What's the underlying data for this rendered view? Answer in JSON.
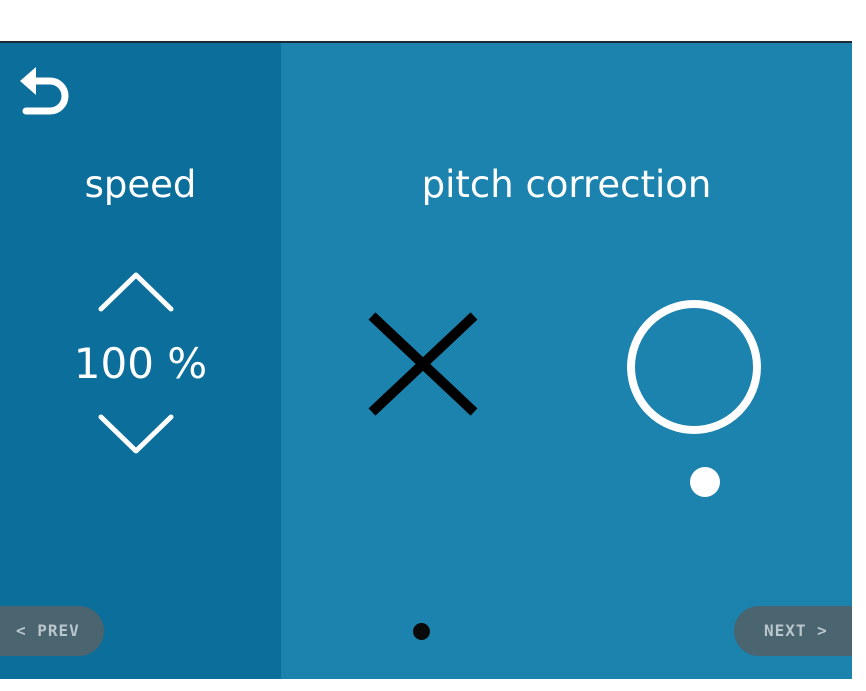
{
  "left_panel": {
    "title": "speed",
    "value": "100 %",
    "up_icon": "chevron-up-icon",
    "down_icon": "chevron-down-icon"
  },
  "right_panel": {
    "title": "pitch correction",
    "options": [
      {
        "icon": "cross-icon",
        "state": "off"
      },
      {
        "icon": "circle-icon",
        "state": "on",
        "selected": true
      }
    ]
  },
  "navigation": {
    "back_icon": "back-arrow-icon",
    "prev_label": "< PREV",
    "next_label": "NEXT >"
  },
  "pagination": {
    "current_page": 1
  },
  "colors": {
    "background": "#1b83ad",
    "left_panel": "#0b6e9b",
    "nav_pill": "#4a6470",
    "text": "#ffffff"
  }
}
